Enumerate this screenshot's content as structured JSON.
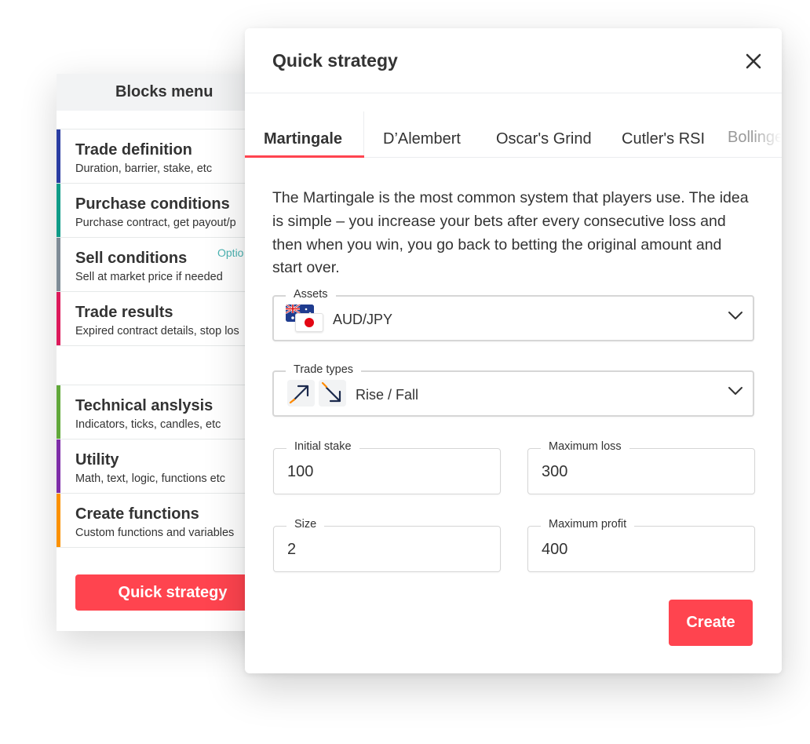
{
  "blocks_menu": {
    "title": "Blocks menu",
    "items": [
      {
        "title": "Trade definition",
        "subtitle": "Duration, barrier, stake, etc",
        "color": "#2a3da2"
      },
      {
        "title": "Purchase conditions",
        "subtitle": "Purchase contract, get payout/p",
        "color": "#109c88"
      },
      {
        "title": "Sell conditions",
        "subtitle": "Sell at market price if needed",
        "badge": "Optio",
        "color": "#7f8c97"
      },
      {
        "title": "Trade results",
        "subtitle": "Expired contract details, stop los",
        "color": "#dd1a5b"
      },
      {
        "title": "Technical anslysis",
        "subtitle": "Indicators, ticks, candles, etc",
        "color": "#61a83a"
      },
      {
        "title": "Utility",
        "subtitle": "Math, text, logic, functions etc",
        "color": "#7e2da8"
      },
      {
        "title": "Create functions",
        "subtitle": "Custom functions and variables",
        "color": "#fb9100"
      }
    ],
    "quick_strategy_button": "Quick strategy"
  },
  "modal": {
    "title": "Quick strategy",
    "tabs": [
      "Martingale",
      "D’Alembert",
      "Oscar's Grind",
      "Cutler's RSI",
      "Bollinger"
    ],
    "active_tab": "Martingale",
    "description": "The Martingale is the most common system that players use. The idea is simple – you increase your bets after every consecutive loss and then when you win, you go back to betting the original amount and start over.",
    "assets": {
      "label": "Assets",
      "value": "AUD/JPY"
    },
    "trade_types": {
      "label": "Trade types",
      "value": "Rise / Fall"
    },
    "initial_stake": {
      "label": "Initial stake",
      "value": "100"
    },
    "maximum_loss": {
      "label": "Maximum loss",
      "value": "300"
    },
    "size": {
      "label": "Size",
      "value": "2"
    },
    "maximum_profit": {
      "label": "Maximum profit",
      "value": "400"
    },
    "create_button": "Create"
  },
  "colors": {
    "accent": "#ff444f",
    "trade_rise": "#16a5a0",
    "trade_fall": "#ff444f",
    "icon_arrow": "#333333"
  },
  "icons": {
    "close": "close-icon",
    "chevron": "chevron-down-icon",
    "rise": "rise-arrow-icon",
    "fall": "fall-arrow-icon"
  }
}
